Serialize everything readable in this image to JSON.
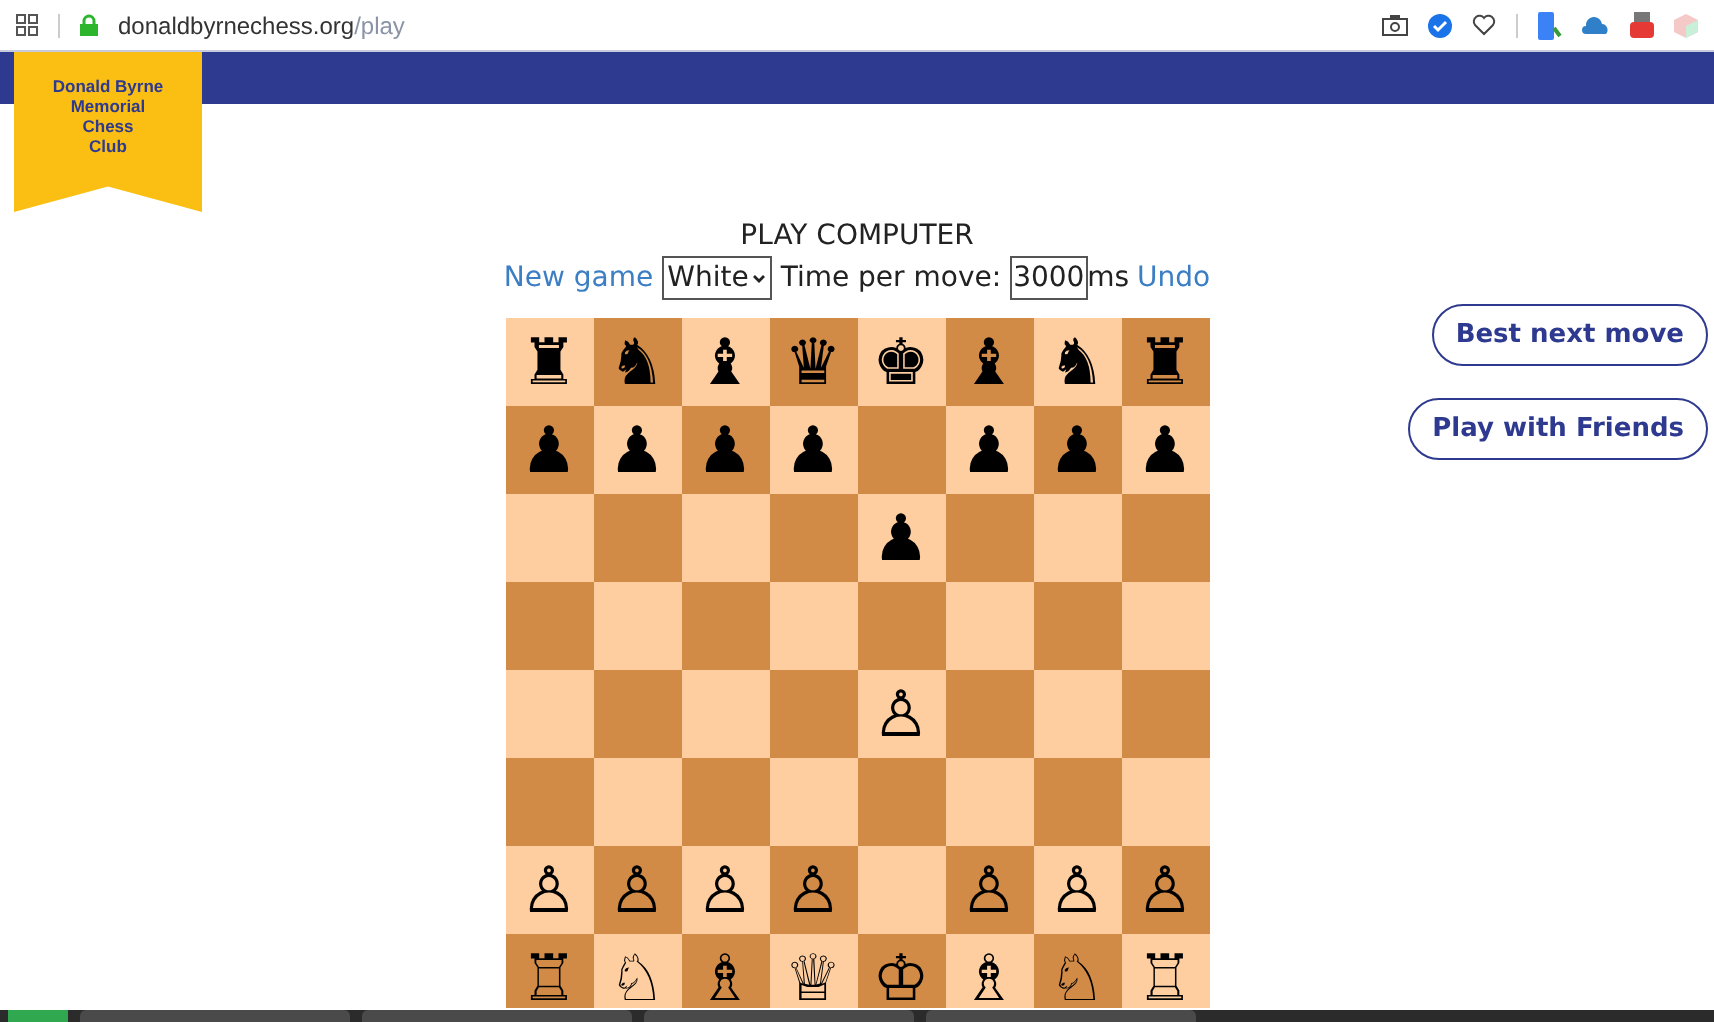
{
  "browser": {
    "url_host": "donaldbyrnechess.org",
    "url_path": "/play"
  },
  "logo": {
    "lines": [
      "Donald Byrne",
      "Memorial",
      "Chess",
      "Club"
    ]
  },
  "title": "PLAY COMPUTER",
  "controls": {
    "new_game": "New game",
    "side": "White",
    "time_label": "Time per move:",
    "time_value": "3000",
    "time_unit": "ms",
    "undo": "Undo"
  },
  "board": [
    [
      {
        "color": "#fecea0",
        "piece": "♜"
      },
      {
        "color": "#d18b47",
        "piece": "♞"
      },
      {
        "color": "#fecea0",
        "piece": "♝"
      },
      {
        "color": "#d18b47",
        "piece": "♛"
      },
      {
        "color": "#fecea0",
        "piece": "♚"
      },
      {
        "color": "#d18b47",
        "piece": "♝"
      },
      {
        "color": "#fecea0",
        "piece": "♞"
      },
      {
        "color": "#d18b47",
        "piece": "♜"
      }
    ],
    [
      {
        "color": "#d18b47",
        "piece": "♟"
      },
      {
        "color": "#fecea0",
        "piece": "♟"
      },
      {
        "color": "#d18b47",
        "piece": "♟"
      },
      {
        "color": "#fecea0",
        "piece": "♟"
      },
      {
        "color": "#d18b47"
      },
      {
        "color": "#fecea0",
        "piece": "♟"
      },
      {
        "color": "#d18b47",
        "piece": "♟"
      },
      {
        "color": "#fecea0",
        "piece": "♟"
      }
    ],
    [
      {
        "color": "#fecea0"
      },
      {
        "color": "#d18b47"
      },
      {
        "color": "#fecea0"
      },
      {
        "color": "#d18b47"
      },
      {
        "color": "#fecea0",
        "piece": "♟"
      },
      {
        "color": "#d18b47"
      },
      {
        "color": "#fecea0"
      },
      {
        "color": "#d18b47"
      }
    ],
    [
      {
        "color": "#d18b47"
      },
      {
        "color": "#fecea0"
      },
      {
        "color": "#d18b47"
      },
      {
        "color": "#fecea0"
      },
      {
        "color": "#d18b47"
      },
      {
        "color": "#fecea0"
      },
      {
        "color": "#d18b47"
      },
      {
        "color": "#fecea0"
      }
    ],
    [
      {
        "color": "#fecea0"
      },
      {
        "color": "#d18b47"
      },
      {
        "color": "#fecea0"
      },
      {
        "color": "#d18b47"
      },
      {
        "color": "#fecea0",
        "piece": "♙"
      },
      {
        "color": "#d18b47"
      },
      {
        "color": "#fecea0"
      },
      {
        "color": "#d18b47"
      }
    ],
    [
      {
        "color": "#d18b47"
      },
      {
        "color": "#fecea0"
      },
      {
        "color": "#d18b47"
      },
      {
        "color": "#fecea0"
      },
      {
        "color": "#d18b47"
      },
      {
        "color": "#fecea0"
      },
      {
        "color": "#d18b47"
      },
      {
        "color": "#fecea0"
      }
    ],
    [
      {
        "color": "#fecea0",
        "piece": "♙"
      },
      {
        "color": "#d18b47",
        "piece": "♙"
      },
      {
        "color": "#fecea0",
        "piece": "♙"
      },
      {
        "color": "#d18b47",
        "piece": "♙"
      },
      {
        "color": "#fecea0"
      },
      {
        "color": "#d18b47",
        "piece": "♙"
      },
      {
        "color": "#fecea0",
        "piece": "♙"
      },
      {
        "color": "#d18b47",
        "piece": "♙"
      }
    ],
    [
      {
        "color": "#d18b47",
        "piece": "♖"
      },
      {
        "color": "#fecea0",
        "piece": "♘"
      },
      {
        "color": "#d18b47",
        "piece": "♗"
      },
      {
        "color": "#fecea0",
        "piece": "♕"
      },
      {
        "color": "#d18b47",
        "piece": "♔"
      },
      {
        "color": "#fecea0",
        "piece": "♗"
      },
      {
        "color": "#d18b47",
        "piece": "♘"
      },
      {
        "color": "#fecea0",
        "piece": "♖"
      }
    ]
  ],
  "side_buttons": [
    "Best next move",
    "Play with Friends"
  ]
}
